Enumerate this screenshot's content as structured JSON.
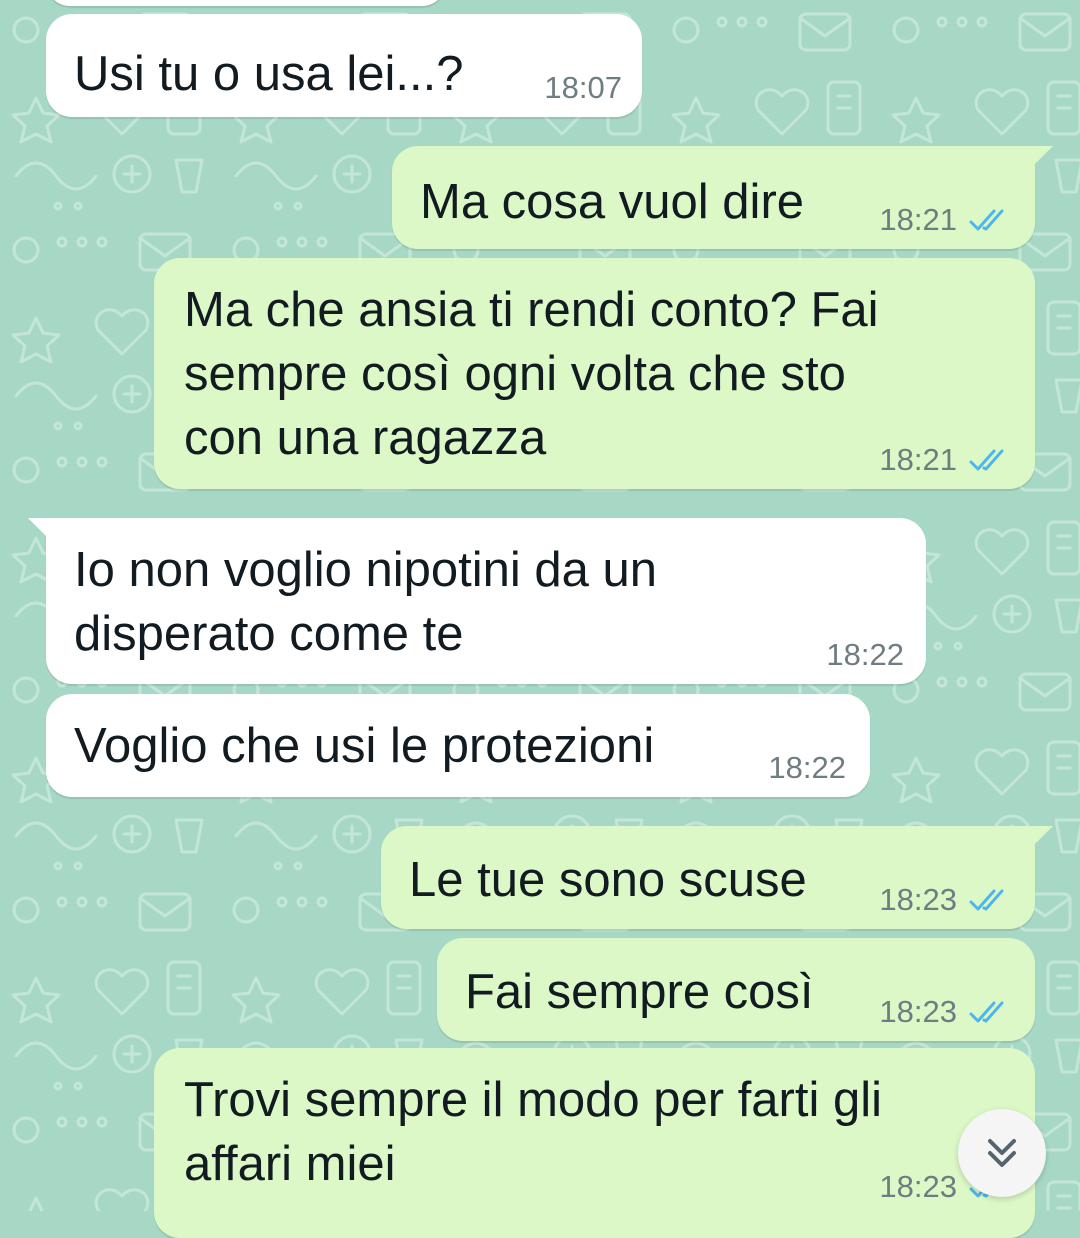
{
  "messages": [
    {
      "direction": "incoming",
      "text": "Usi tu o usa lei...?",
      "time": "18:07"
    },
    {
      "direction": "outgoing",
      "text": "Ma cosa vuol dire",
      "time": "18:21",
      "status": "read"
    },
    {
      "direction": "outgoing",
      "lines": [
        "Ma che ansia ti rendi conto? Fai",
        "sempre così ogni volta che sto",
        "con una ragazza"
      ],
      "time": "18:21",
      "status": "read"
    },
    {
      "direction": "incoming",
      "lines": [
        "Io non voglio nipotini da un",
        "disperato come te"
      ],
      "time": "18:22"
    },
    {
      "direction": "incoming",
      "text": "Voglio che usi le protezioni",
      "time": "18:22"
    },
    {
      "direction": "outgoing",
      "text": "Le tue sono scuse",
      "time": "18:23",
      "status": "read"
    },
    {
      "direction": "outgoing",
      "text": "Fai sempre così",
      "time": "18:23",
      "status": "read"
    },
    {
      "direction": "outgoing",
      "lines": [
        "Trovi sempre il modo per farti gli",
        "affari miei"
      ],
      "time": "18:23",
      "status": "read"
    }
  ],
  "icons": {
    "read_receipt": "double-check-icon",
    "scroll_down": "chevrons-down-icon"
  },
  "colors": {
    "wallpaper": "#a7d8c6",
    "incoming_bubble": "#ffffff",
    "outgoing_bubble": "#dcf8c6",
    "read_tick": "#4fb6ec",
    "timestamp": "#6f7c82"
  }
}
